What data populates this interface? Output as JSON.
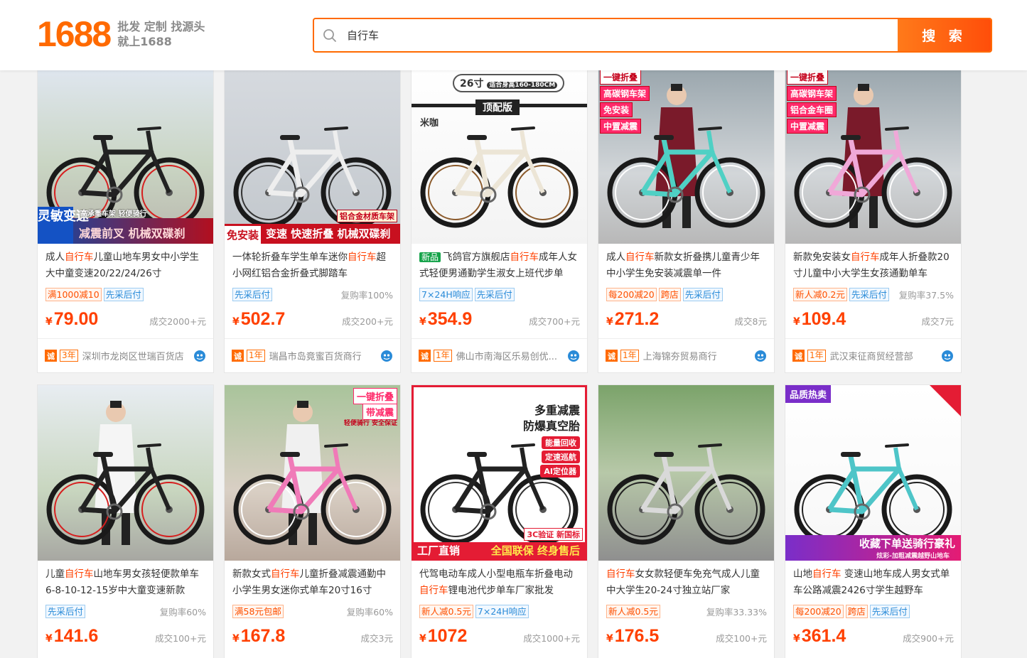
{
  "header": {
    "logo_num": "1688",
    "slogan_line1": "批发 定制 找源头",
    "slogan_line2": "就上1688",
    "search_value": "自行车",
    "search_button": "搜 索"
  },
  "products": [
    {
      "title_pre": "成人",
      "kw": "自行车",
      "title_post": "儿童山地车男女中小学生大中童变速20/22/24/26寸",
      "tags": [
        {
          "t": "满1000减10",
          "c": "or"
        },
        {
          "t": "先采后付",
          "c": "bl"
        }
      ],
      "repeat": "",
      "price": "79.00",
      "sales": "成交2000+元",
      "years": "3年",
      "shop": "深圳市龙岗区世瑞百货店",
      "img_text1": "灵敏变速",
      "img_text2": "减震前叉  机械双碟刹",
      "img_chip": "高承重车架  轻便骑行"
    },
    {
      "title_pre": "一体轮折叠车学生单车迷你",
      "kw": "自行车",
      "title_post": "超小网红铝合金折叠式脚踏车",
      "tags": [
        {
          "t": "先采后付",
          "c": "bl"
        }
      ],
      "repeat": "复购率100%",
      "price": "502.7",
      "sales": "成交200+元",
      "years": "1年",
      "shop": "瑞昌市岛竟蜜百货商行",
      "img_text1": "免安装",
      "img_text2": "变速 快速折叠 机械双碟刹",
      "img_chip": "铝合金材质车架"
    },
    {
      "title_pre": "飞鸽官方旗舰店",
      "kw": "自行车",
      "title_post": "成年人女式轻便男通勤学生淑女上班代步单",
      "is_new": "新品",
      "tags": [
        {
          "t": "7×24H响应",
          "c": "bl"
        },
        {
          "t": "先采后付",
          "c": "bl"
        }
      ],
      "repeat": "",
      "price": "354.9",
      "sales": "成交700+元",
      "years": "1年",
      "shop": "佛山市南海区乐易创优...",
      "img_text1": "26寸",
      "img_text2": "顶配版",
      "img_chip": "适合身高160-180CM",
      "img_brand": "米咖"
    },
    {
      "title_pre": "成人",
      "kw": "自行车",
      "title_post": "新款女折叠携儿童青少年中小学生免安装减震单一件",
      "tags": [
        {
          "t": "每200减20",
          "c": "or"
        },
        {
          "t": "跨店",
          "c": "or"
        },
        {
          "t": "先采后付",
          "c": "bl"
        }
      ],
      "repeat": "",
      "price": "271.2",
      "sales": "成交8元",
      "years": "1年",
      "shop": "上海锦夯贸易商行",
      "img_labels": [
        "一键折叠",
        "高碳钢车架",
        "免安装",
        "中置减震"
      ]
    },
    {
      "title_pre": "新款免安装女",
      "kw": "自行车",
      "title_post": "成年人折叠款20寸儿童中小大学生女孩通勤单车",
      "tags": [
        {
          "t": "新人减0.2元",
          "c": "or"
        },
        {
          "t": "先采后付",
          "c": "bl"
        }
      ],
      "repeat": "复购率37.5%",
      "price": "109.4",
      "sales": "成交7元",
      "years": "1年",
      "shop": "武汉束征商贸经营部",
      "img_labels": [
        "一键折叠",
        "高碳钢车架",
        "铝合金车圈",
        "中置减震"
      ]
    },
    {
      "title_pre": "儿童",
      "kw": "自行车",
      "title_post": "山地车男女孩轻便款单车6-8-10-12-15岁中大童变速新款",
      "tags": [
        {
          "t": "先采后付",
          "c": "bl"
        }
      ],
      "repeat": "复购率60%",
      "price": "141.6",
      "sales": "成交100+元"
    },
    {
      "title_pre": "新款女式",
      "kw": "自行车",
      "title_post": "儿童折叠减震通勤中小学生男女迷你式单车20寸16寸",
      "tags": [
        {
          "t": "满58元包邮",
          "c": "or"
        }
      ],
      "repeat": "复购率60%",
      "price": "167.8",
      "sales": "成交3元",
      "img_labels": [
        "一键折叠",
        "带减震"
      ],
      "img_chip": "轻便骑行 安全保证"
    },
    {
      "title_pre": "代驾电动车成人小型电瓶车折叠电动",
      "kw": "自行车",
      "title_post": "锂电池代步单车厂家批发",
      "tags": [
        {
          "t": "新人减0.5元",
          "c": "or"
        },
        {
          "t": "7×24H响应",
          "c": "bl"
        }
      ],
      "repeat": "",
      "price": "1072",
      "sales": "成交1000+元",
      "img_text1": "多重减震",
      "img_text2": "防爆真空胎",
      "img_labels": [
        "能量回收",
        "定速巡航",
        "AI定位器"
      ],
      "img_chip": "3C验证 新国标",
      "img_foot1": "工厂直销",
      "img_foot2": "全国联保 终身售后"
    },
    {
      "title_pre": "",
      "kw": "自行车",
      "title_post": "女女款轻便车免充气成人儿童中大学生20-24寸独立站厂家",
      "tags": [
        {
          "t": "新人减0.5元",
          "c": "or"
        }
      ],
      "repeat": "复购率33.33%",
      "price": "176.5",
      "sales": "成交100+元"
    },
    {
      "title_pre": "山地",
      "kw": "自行车",
      "title_post": " 变速山地车成人男女式单车公路减震2426寸学生越野车",
      "tags": [
        {
          "t": "每200减20",
          "c": "or"
        },
        {
          "t": "跨店",
          "c": "or"
        },
        {
          "t": "先采后付",
          "c": "bl"
        }
      ],
      "repeat": "",
      "price": "361.4",
      "sales": "成交900+元",
      "img_text1": "品质热卖",
      "img_text2": "收藏下单送骑行豪礼",
      "img_chip": "炫彩-加粗减震越野山地车"
    }
  ],
  "colors": {
    "accent": "#ff6a00",
    "price": "#ff4000",
    "blue_tag": "#2a8bd8"
  }
}
